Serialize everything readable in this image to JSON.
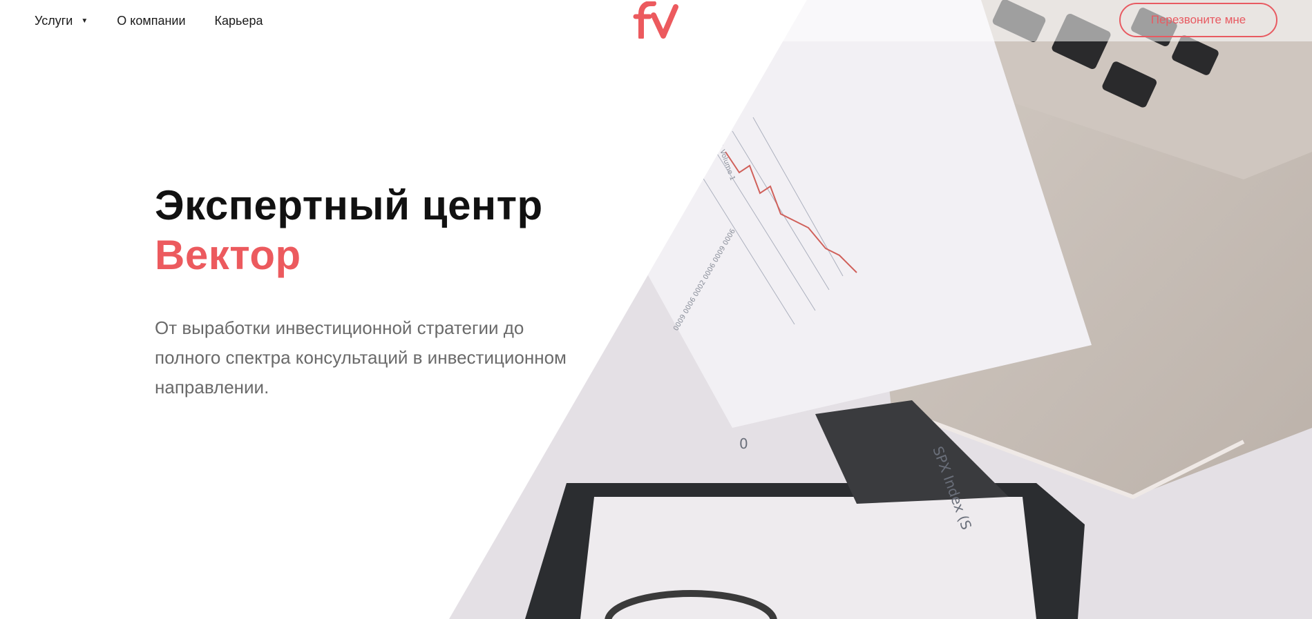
{
  "header": {
    "nav": [
      {
        "label": "Услуги",
        "has_dropdown": true,
        "caret": "▼"
      },
      {
        "label": "О компании",
        "has_dropdown": false
      },
      {
        "label": "Карьера",
        "has_dropdown": false
      }
    ],
    "logo_icon": "fv-logo",
    "cta_label": "Перезвоните мне"
  },
  "hero": {
    "title_line1": "Экспертный центр",
    "title_line2": "Вектор",
    "subtitle": "От выработки инвестиционной стратегии до полного спектра консультаций в инвестиционном направлении.",
    "image_description_icon": "finance-documents-laptop-photo"
  },
  "colors": {
    "accent": "#ec5a5e",
    "title": "#111111",
    "subtitle": "#6a6a6a",
    "photo_bg": "#e6e2e6",
    "laptop": "#c9c0b9"
  }
}
